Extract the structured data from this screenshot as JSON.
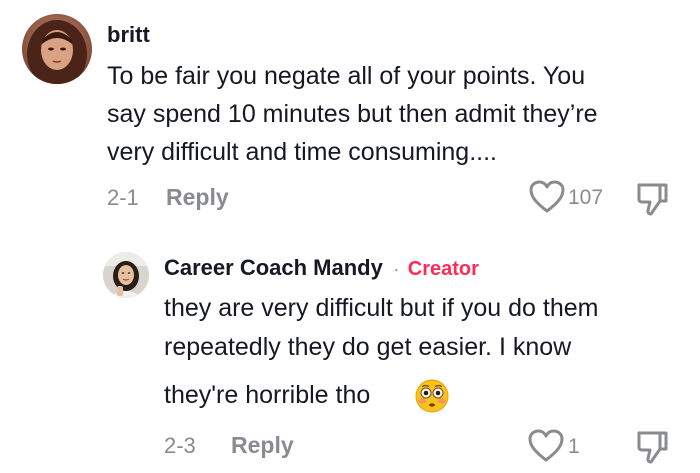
{
  "comment": {
    "username": "britt",
    "avatar_icon": "user-avatar",
    "text_line1": "To be fair you negate all of your points. You",
    "text_line2": "say spend 10 minutes but then admit they’re",
    "text_line3": "very difficult and time consuming....",
    "date": "2-1",
    "reply_label": "Reply",
    "like_count": "107",
    "like_icon": "heart-icon",
    "dislike_icon": "thumbs-down-icon"
  },
  "reply": {
    "username": "Career Coach Mandy",
    "separator": "·",
    "badge": "Creator",
    "avatar_icon": "user-avatar",
    "text_line1": "they are very difficult but if you do them",
    "text_line2": "repeatedly they do get easier. I know",
    "text_line3": "they're horrible tho",
    "emoji": "flushed-face-emoji",
    "date": "2-3",
    "reply_label": "Reply",
    "like_count": "1",
    "like_icon": "heart-icon",
    "dislike_icon": "thumbs-down-icon"
  },
  "colors": {
    "text": "#161823",
    "muted": "#8a8b91",
    "creator": "#fe2c55"
  }
}
